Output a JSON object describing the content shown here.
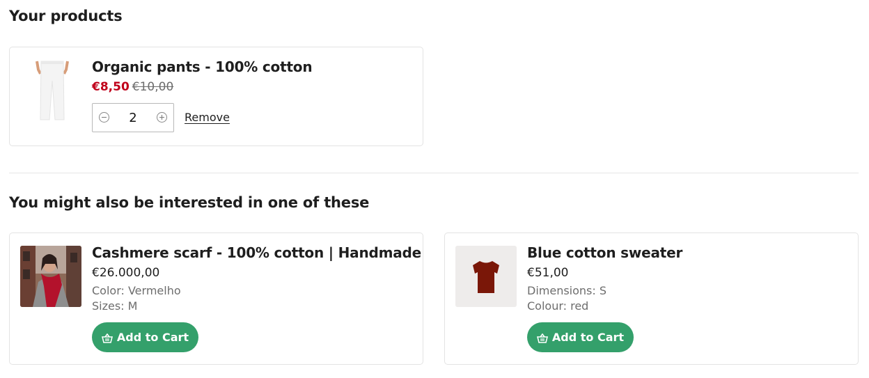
{
  "cart": {
    "heading": "Your products",
    "item": {
      "title": "Organic pants - 100% cotton",
      "sale_price": "€8,50",
      "original_price": "€10,00",
      "quantity": "2",
      "remove_label": "Remove"
    }
  },
  "recommendations": {
    "heading": "You might also be interested in one of these",
    "items": [
      {
        "title": "Cashmere scarf - 100% cotton | Handmade",
        "price": "€26.000,00",
        "attr1": "Color: Vermelho",
        "attr2": "Sizes: M",
        "button_label": "Add to Cart"
      },
      {
        "title": "Blue cotton sweater",
        "price": "€51,00",
        "attr1": "Dimensions: S",
        "attr2": "Colour: red",
        "button_label": "Add to Cart"
      }
    ]
  },
  "colors": {
    "sale": "#c0001a",
    "button": "#34a06b",
    "shirt": "#7a1708"
  },
  "icons": [
    "minus-circle-icon",
    "plus-circle-icon",
    "basket-icon"
  ]
}
